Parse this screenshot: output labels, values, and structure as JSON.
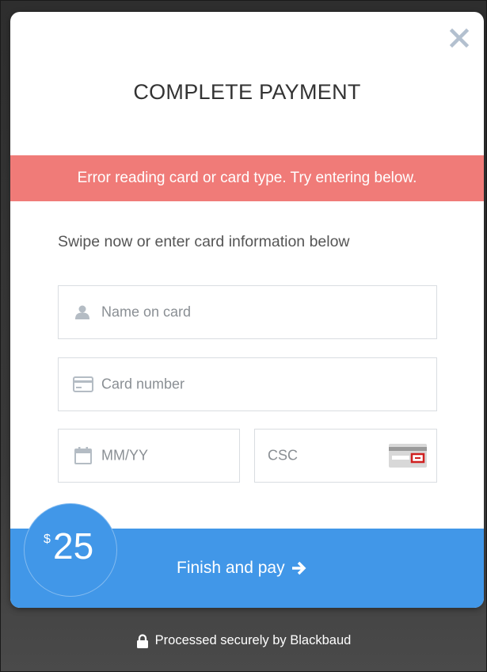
{
  "modal": {
    "title": "COMPLETE PAYMENT",
    "error_message": "Error reading card or card type. Try entering below.",
    "instructions": "Swipe now or enter card information below"
  },
  "form": {
    "name_placeholder": "Name on card",
    "card_number_placeholder": "Card number",
    "expiry_placeholder": "MM/YY",
    "csc_placeholder": "CSC"
  },
  "footer": {
    "currency_symbol": "$",
    "amount": "25",
    "pay_label": "Finish and pay"
  },
  "secure_note": "Processed securely by Blackbaud",
  "icons": {
    "close": "close-icon",
    "name": "user-icon",
    "card": "credit-card-icon",
    "expiry": "calendar-icon",
    "csc": "card-back-icon",
    "pay": "arrow-right-icon",
    "secure": "lock-icon"
  },
  "colors": {
    "error_banner": "#f07b78",
    "accent": "#4197e8",
    "backdrop": "#333333",
    "close_icon": "#b3c0cf"
  }
}
